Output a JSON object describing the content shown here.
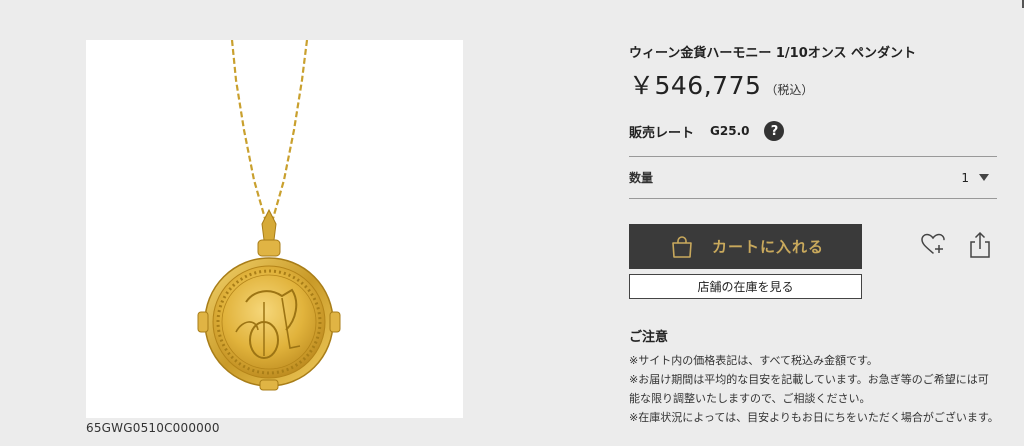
{
  "product": {
    "sku": "65GWG0510C000000",
    "title": "ウィーン金貨ハーモニー 1/10オンス ペンダント",
    "price": "￥546,775",
    "tax_note": "（税込）"
  },
  "rate": {
    "label": "販売レート",
    "value": "G25.0",
    "help": "?"
  },
  "quantity": {
    "label": "数量",
    "value": "1"
  },
  "actions": {
    "cart_label": "カートに入れる",
    "store_stock_label": "店舗の在庫を見る"
  },
  "notice": {
    "title": "ご注意",
    "items": [
      "※サイト内の価格表記は、すべて税込み金額です。",
      "※お届け期間は平均的な目安を記載しています。お急ぎ等のご希望には可能な限り調整いたしますので、ご相談ください。",
      "※在庫状況によっては、目安よりもお日にちをいただく場合がございます。"
    ]
  },
  "colors": {
    "background": "#ececec",
    "cart_button_bg": "#3a3a3a",
    "cart_button_text": "#c9a95c",
    "gold": "#d4a82a"
  },
  "icons": {
    "cart": "shopping-bag-icon",
    "wishlist": "heart-plus-icon",
    "share": "share-icon",
    "help": "question-circle-icon",
    "quantity_caret": "caret-down-icon"
  }
}
